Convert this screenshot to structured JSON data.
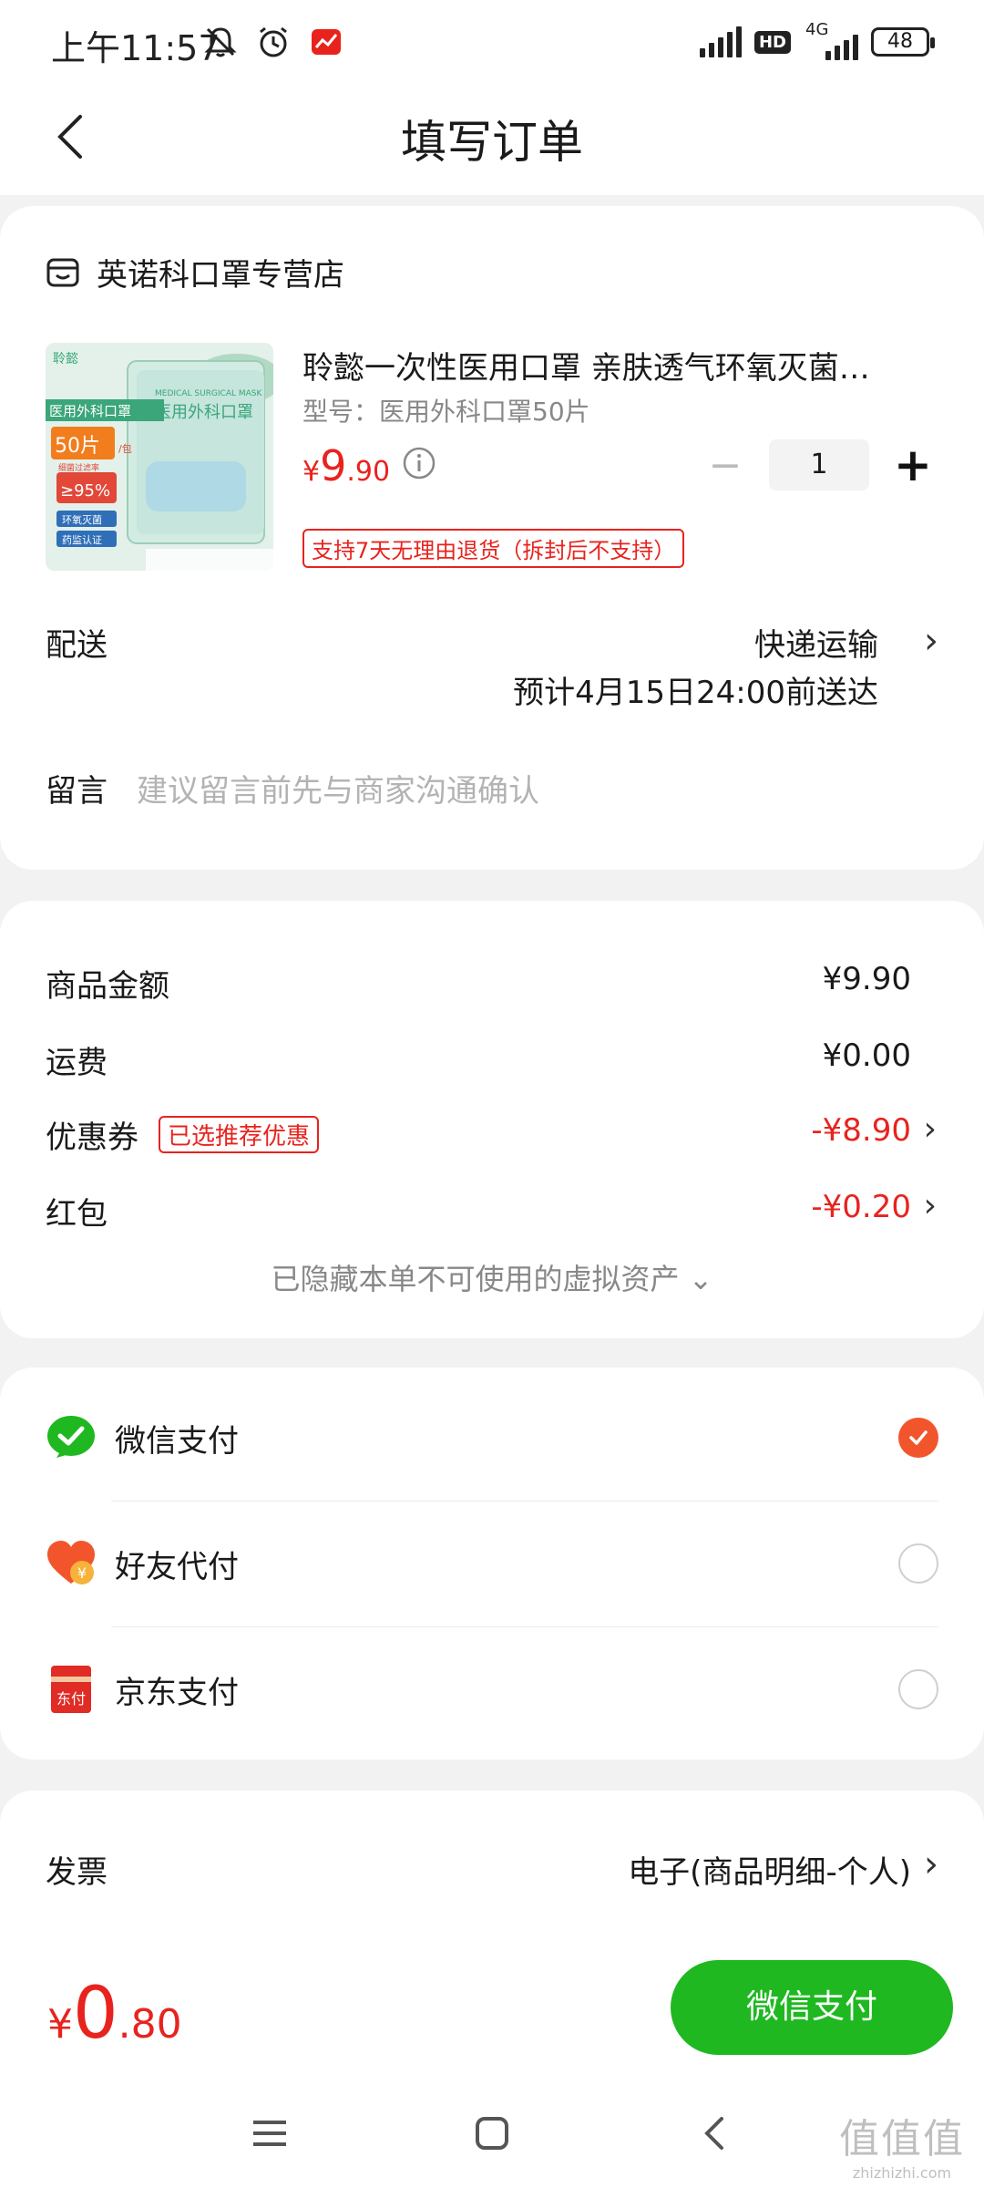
{
  "status_bar": {
    "time": "上午11:57",
    "network_label": "4G",
    "hd_label": "HD",
    "battery": "48"
  },
  "header": {
    "title": "填写订单"
  },
  "store": {
    "name": "英诺科口罩专营店"
  },
  "product": {
    "title": "聆懿一次性医用口罩 亲肤透气环氧灭菌…",
    "spec": "型号：医用外科口罩50片",
    "price_yen": "¥",
    "price_int": "9",
    "price_dec": ".90",
    "quantity": "1",
    "return_policy": "支持7天无理由退货（拆封后不支持）",
    "image": {
      "brand": "聆懿",
      "en_label": "MEDICAL SURGICAL MASK",
      "cn_label": "医用外科口罩",
      "cn_label_box": "医用外科口罩",
      "count": "50片",
      "per_bag": "/包",
      "filter_text": "细菌过滤率",
      "filter_pct": "≥95%",
      "sterile": "环氧灭菌",
      "certified": "药监认证"
    }
  },
  "delivery": {
    "label": "配送",
    "method": "快递运输",
    "eta": "预计4月15日24:00前送达"
  },
  "memo": {
    "label": "留言",
    "placeholder": "建议留言前先与商家沟通确认"
  },
  "summary": {
    "goods_label": "商品金额",
    "goods_value": "¥9.90",
    "shipping_label": "运费",
    "shipping_value": "¥0.00",
    "coupon_label": "优惠券",
    "coupon_badge": "已选推荐优惠",
    "coupon_value": "-¥8.90",
    "redpacket_label": "红包",
    "redpacket_value": "-¥0.20",
    "hidden_note": "已隐藏本单不可使用的虚拟资产 ⌄"
  },
  "payment": {
    "options": [
      {
        "label": "微信支付",
        "selected": true
      },
      {
        "label": "好友代付",
        "selected": false
      },
      {
        "label": "京东支付",
        "selected": false
      }
    ],
    "jd_icon_text": "东付",
    "friend_icon_text": "¥"
  },
  "invoice": {
    "label": "发票",
    "value": "电子(商品明细-个人)"
  },
  "bottom": {
    "total_yen": "¥",
    "total_int": "0",
    "total_dec": ".80",
    "pay_button": "微信支付"
  },
  "watermark": {
    "top": "值值值",
    "bottom": "zhizhizhi.com"
  },
  "colors": {
    "accent_red": "#e8231e",
    "wechat_green": "#1fb821",
    "radio_selected": "#f2552c"
  }
}
